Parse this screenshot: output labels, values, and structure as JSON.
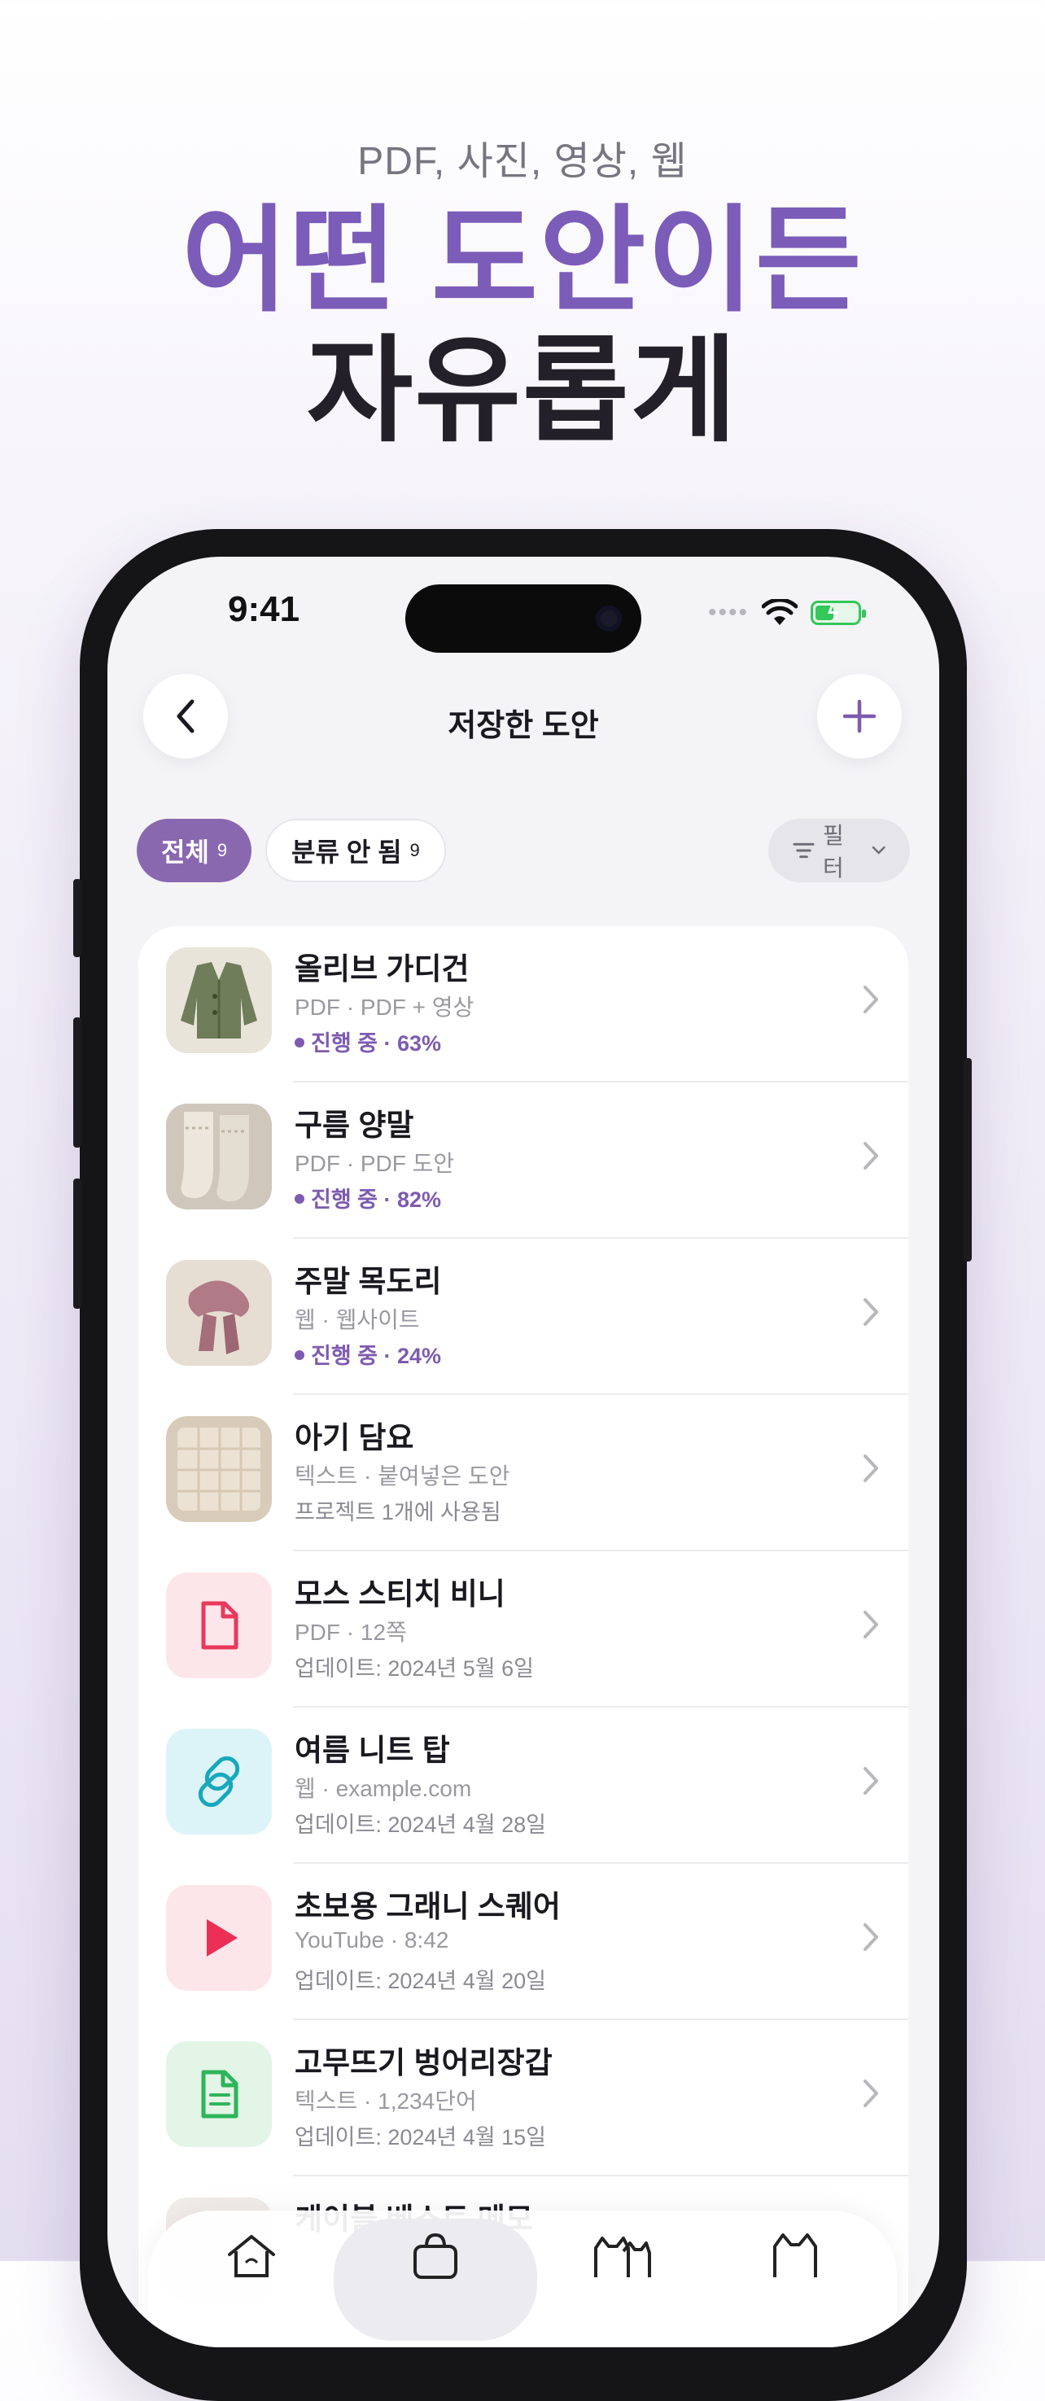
{
  "marketing": {
    "subtitle": "PDF, 사진, 영상, 웹",
    "headline_line1": "어떤 도안이든",
    "headline_line2": "자유롭게"
  },
  "status_bar": {
    "time": "9:41",
    "signal_dots": "••••"
  },
  "nav": {
    "title": "저장한 도안",
    "back_icon": "chevron-left-icon",
    "add_icon": "plus-icon"
  },
  "filters": {
    "all_label": "전체",
    "all_count": "9",
    "uncategorized_label": "분류 안 됨",
    "uncategorized_count": "9",
    "filter_label": "필터"
  },
  "colors": {
    "accent": "#7e5bb0",
    "headline_purple": "#7b5cb8"
  },
  "patterns": [
    {
      "title": "올리브 가디건",
      "subtitle": "PDF · PDF + 영상",
      "status": "진행 중 · 63%",
      "progress": 63,
      "thumb": "olive-cardigan-photo"
    },
    {
      "title": "구름 양말",
      "subtitle": "PDF · PDF 도안",
      "status": "진행 중 · 82%",
      "progress": 82,
      "thumb": "cloud-socks-photo"
    },
    {
      "title": "주말 목도리",
      "subtitle": "웹 · 웹사이트",
      "status": "진행 중 · 24%",
      "progress": 24,
      "thumb": "weekend-scarf-photo"
    },
    {
      "title": "아기 담요",
      "subtitle": "텍스트 · 붙여넣은 도안",
      "meta": "프로젝트 1개에 사용됨",
      "thumb": "baby-blanket-photo"
    },
    {
      "title": "모스 스티치 비니",
      "subtitle": "PDF · 12쪽",
      "meta": "업데이트: 2024년 5월 6일",
      "icon": "pdf-file-icon"
    },
    {
      "title": "여름 니트 탑",
      "subtitle": "웹 · example.com",
      "meta": "업데이트: 2024년 4월 28일",
      "icon": "link-icon"
    },
    {
      "title": "초보용 그래니 스퀘어",
      "subtitle": "YouTube · 8:42",
      "meta": "업데이트: 2024년 4월 20일",
      "icon": "play-icon"
    },
    {
      "title": "고무뜨기 벙어리장갑",
      "subtitle": "텍스트 · 1,234단어",
      "meta": "업데이트: 2024년 4월 15일",
      "icon": "text-file-icon"
    },
    {
      "title": "케이블 베스트 메모",
      "subtitle": "",
      "meta": ""
    }
  ],
  "tabbar": {
    "items": [
      "home-icon",
      "patterns-bag-icon",
      "cats-icon",
      "cat-icon"
    ],
    "active_index": 1
  }
}
